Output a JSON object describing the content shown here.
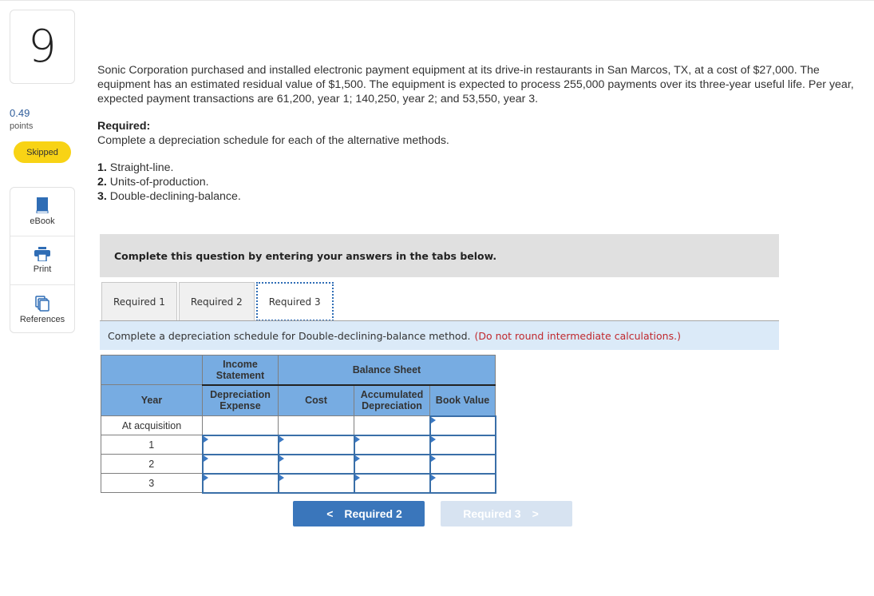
{
  "sidebar": {
    "question_number": "9",
    "points_value": "0.49",
    "points_label": "points",
    "status_badge": "Skipped",
    "tools": [
      {
        "label": "eBook",
        "icon": "book-icon"
      },
      {
        "label": "Print",
        "icon": "printer-icon"
      },
      {
        "label": "References",
        "icon": "copy-icon"
      }
    ]
  },
  "problem": {
    "text": "Sonic Corporation purchased and installed electronic payment equipment at its drive-in restaurants in San Marcos, TX, at a cost of $27,000. The equipment has an estimated residual value of $1,500. The equipment is expected to process 255,000 payments over its three-year useful life. Per year, expected payment transactions are 61,200, year 1; 140,250, year 2; and 53,550, year 3.",
    "required_heading": "Required:",
    "required_text": "Complete a depreciation schedule for each of the alternative methods.",
    "items": [
      {
        "num": "1.",
        "text": "Straight-line."
      },
      {
        "num": "2.",
        "text": "Units-of-production."
      },
      {
        "num": "3.",
        "text": "Double-declining-balance."
      }
    ]
  },
  "panel": {
    "banner": "Complete this question by entering your answers in the tabs below.",
    "tabs": [
      {
        "label": "Required 1",
        "active": false
      },
      {
        "label": "Required 2",
        "active": false
      },
      {
        "label": "Required 3",
        "active": true
      }
    ],
    "instruction": "Complete a depreciation schedule for Double-declining-balance method.",
    "instruction_note": "(Do not round intermediate calculations.)"
  },
  "table": {
    "group_headers": {
      "income_statement": "Income Statement",
      "balance_sheet": "Balance Sheet"
    },
    "columns": {
      "year": "Year",
      "depreciation_expense": "Depreciation Expense",
      "cost": "Cost",
      "accumulated_depreciation": "Accumulated Depreciation",
      "book_value": "Book Value"
    },
    "rows": [
      {
        "year": "At acquisition",
        "depreciation_expense": "",
        "cost": "",
        "accumulated_depreciation": "",
        "book_value": ""
      },
      {
        "year": "1",
        "depreciation_expense": "",
        "cost": "",
        "accumulated_depreciation": "",
        "book_value": ""
      },
      {
        "year": "2",
        "depreciation_expense": "",
        "cost": "",
        "accumulated_depreciation": "",
        "book_value": ""
      },
      {
        "year": "3",
        "depreciation_expense": "",
        "cost": "",
        "accumulated_depreciation": "",
        "book_value": ""
      }
    ]
  },
  "nav": {
    "prev_label": "Required 2",
    "next_label": "Required 3",
    "prev_chevron": "<",
    "next_chevron": ">"
  }
}
